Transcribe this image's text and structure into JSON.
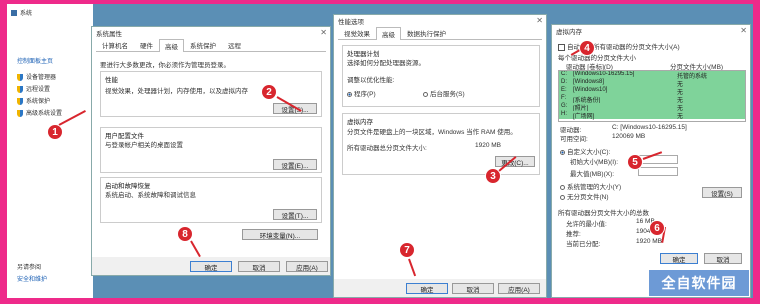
{
  "colors": {
    "frame": "#ee2a8a",
    "desktop": "#5b8fb5",
    "badge": "#d8262e",
    "selected_row": "#7fd39a"
  },
  "left_panel": {
    "title": "系统",
    "home": "控制面板主页",
    "items": [
      "设备管理器",
      "远程设置",
      "系统保护",
      "高级系统设置"
    ],
    "see_also": "另请参阅",
    "security": "安全和维护"
  },
  "sys_props": {
    "title": "系统属性",
    "tabs": [
      "计算机名",
      "硬件",
      "高级",
      "系统保护",
      "远程"
    ],
    "admin_note": "要进行大多数更改，你必须作为管理员登录。",
    "perf_title": "性能",
    "perf_desc": "视觉效果，处理器计划，内存使用，以及虚拟内存",
    "profile_title": "用户配置文件",
    "profile_desc": "与登录帐户相关的桌面设置",
    "startup_title": "启动和故障恢复",
    "startup_desc": "系统启动、系统故障和调试信息",
    "settings_btn": "设置(S)...",
    "settings_btn2": "设置(E)...",
    "settings_btn3": "设置(T)...",
    "env_btn": "环境变量(N)...",
    "ok": "确定",
    "cancel": "取消",
    "apply": "应用(A)"
  },
  "perf_opts": {
    "title": "性能选项",
    "tabs": [
      "视觉效果",
      "高级",
      "数据执行保护"
    ],
    "sched_title": "处理器计划",
    "sched_desc": "选择如何分配处理器资源。",
    "adjust": "调整以优化性能:",
    "programs": "程序(P)",
    "services": "后台服务(S)",
    "vm_title": "虚拟内存",
    "vm_desc": "分页文件是硬盘上的一块区域，Windows 当作 RAM 使用。",
    "total_label": "所有驱动器总分页文件大小:",
    "total_value": "1920 MB",
    "change_btn": "更改(C)...",
    "ok": "确定",
    "cancel": "取消",
    "apply": "应用(A)"
  },
  "virtual_memory": {
    "title": "虚拟内存",
    "auto_manage": "自动管理所有驱动器的分页文件大小(A)",
    "per_drive": "每个驱动器的分页文件大小",
    "col_drive": "驱动器 [卷标](D)",
    "col_size": "分页文件大小(MB)",
    "drives": [
      {
        "drive": "C:",
        "label": "[Windows10-16295.15]",
        "size": "托管的系统"
      },
      {
        "drive": "D:",
        "label": "[Windows8]",
        "size": "无"
      },
      {
        "drive": "E:",
        "label": "[Windows10]",
        "size": "无"
      },
      {
        "drive": "F:",
        "label": "[系统备份]",
        "size": "无"
      },
      {
        "drive": "G:",
        "label": "[照片]",
        "size": "无"
      },
      {
        "drive": "H:",
        "label": "[广场网]",
        "size": "无"
      }
    ],
    "drive_label": "驱动器:",
    "drive_value": "C: [Windows10-16295.15]",
    "avail_label": "可用空间:",
    "avail_value": "120069 MB",
    "custom": "自定义大小(C):",
    "initial": "初始大小(MB)(I):",
    "max": "最大值(MB)(X):",
    "system_managed": "系统管理的大小(Y)",
    "no_paging": "无分页文件(N)",
    "set_btn": "设置(S)",
    "totals_title": "所有驱动器分页文件大小的总数",
    "min_label": "允许的最小值:",
    "min_value": "16 MB",
    "rec_label": "推荐:",
    "rec_value": "1904 MB",
    "cur_label": "当前已分配:",
    "cur_value": "1920 MB",
    "ok": "确定",
    "cancel": "取消"
  },
  "badges": [
    "1",
    "2",
    "3",
    "4",
    "5",
    "6",
    "7",
    "8"
  ],
  "watermark": "全自软件园"
}
